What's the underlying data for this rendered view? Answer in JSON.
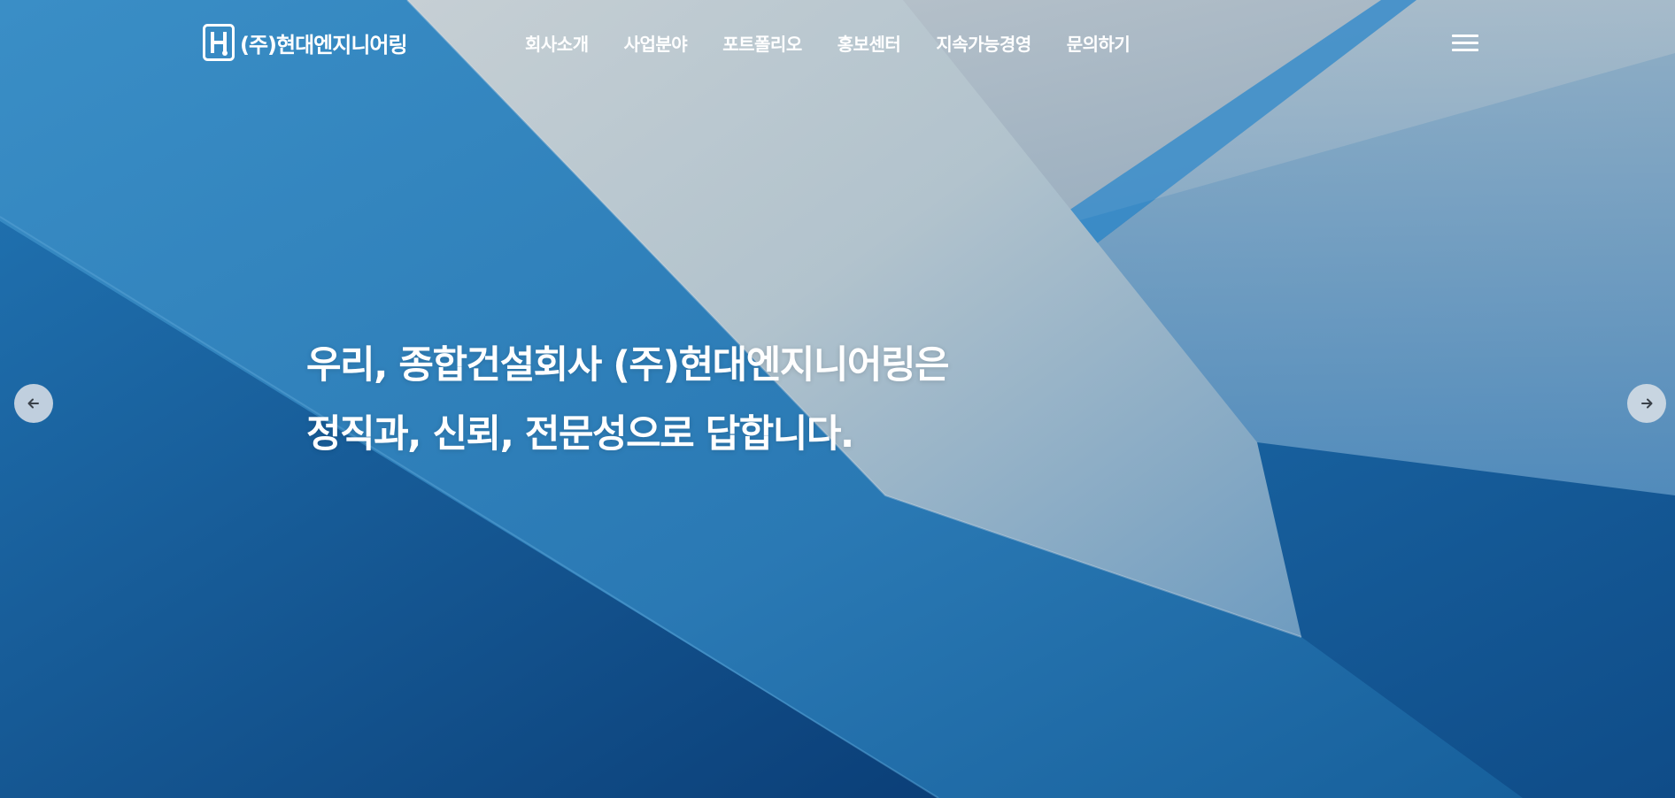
{
  "brand": {
    "logo_text": "(주)현대엔지니어링"
  },
  "nav": {
    "items": [
      {
        "label": "회사소개"
      },
      {
        "label": "사업분야"
      },
      {
        "label": "포트폴리오"
      },
      {
        "label": "홍보센터"
      },
      {
        "label": "지속가능경영"
      },
      {
        "label": "문의하기"
      }
    ],
    "menu_icon": "hamburger-menu-icon"
  },
  "hero": {
    "headline_line1": "우리, 종합건설회사 (주)현대엔지니어링은",
    "headline_line2": "정직과, 신뢰, 전문성으로 답합니다."
  },
  "slider": {
    "prev_icon": "arrow-left-icon",
    "next_icon": "arrow-right-icon"
  },
  "colors": {
    "background_primary": "#1d6ea8",
    "background_dark": "#0e4f8c",
    "text": "#ffffff",
    "arrow_button": "#d7dee6"
  }
}
